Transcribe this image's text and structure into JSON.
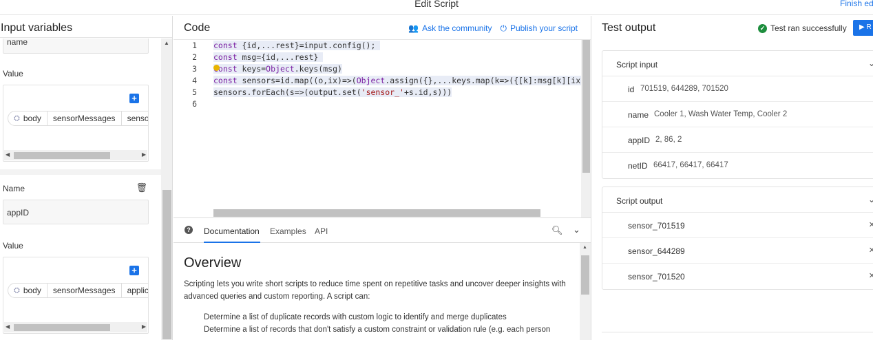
{
  "window": {
    "title": "Edit Script",
    "finish_label": "Finish editing"
  },
  "input_panel": {
    "title": "Input variables",
    "variables": [
      {
        "name_value": "name",
        "value_label": "Value",
        "chips": [
          "body",
          "sensorMessages",
          "senso"
        ]
      },
      {
        "name_label": "Name",
        "name_value": "appID",
        "value_label": "Value",
        "chips": [
          "body",
          "sensorMessages",
          "applic"
        ]
      }
    ]
  },
  "code_panel": {
    "title": "Code",
    "ask_label": "Ask the community",
    "publish_label": "Publish your script",
    "line_numbers": [
      "1",
      "2",
      "3",
      "4",
      "5",
      "6"
    ]
  },
  "docs": {
    "tabs": [
      "Documentation",
      "Examples",
      "API"
    ],
    "heading": "Overview",
    "intro": "Scripting lets you write short scripts to reduce time spent on repetitive tasks and uncover deeper insights with advanced queries and custom reporting. A script can:",
    "items": [
      "Determine a list of duplicate records with custom logic to identify and merge duplicates",
      "Determine a list of records that don't satisfy a custom constraint or validation rule (e.g. each person"
    ]
  },
  "test_panel": {
    "title": "Test output",
    "status": "Test ran successfully",
    "run_label": "▶ R",
    "script_input": {
      "title": "Script input",
      "rows": [
        {
          "key": "id",
          "value": "701519, 644289, 701520"
        },
        {
          "key": "name",
          "value": "Cooler 1, Wash Water Temp, Cooler 2"
        },
        {
          "key": "appID",
          "value": "2, 86, 2"
        },
        {
          "key": "netID",
          "value": "66417, 66417, 66417"
        }
      ]
    },
    "script_output": {
      "title": "Script output",
      "rows": [
        "sensor_701519",
        "sensor_644289",
        "sensor_701520"
      ]
    }
  },
  "icons": {
    "community": "people-icon",
    "publish": "power-icon",
    "help": "help-icon",
    "search": "search-icon",
    "collapse": "chevron-down-icon",
    "success": "check-circle-icon",
    "add": "plus-icon",
    "delete": "trash-icon",
    "field": "cube-icon"
  },
  "colors": {
    "accent": "#1a73e8",
    "success": "#1e8e3e"
  }
}
